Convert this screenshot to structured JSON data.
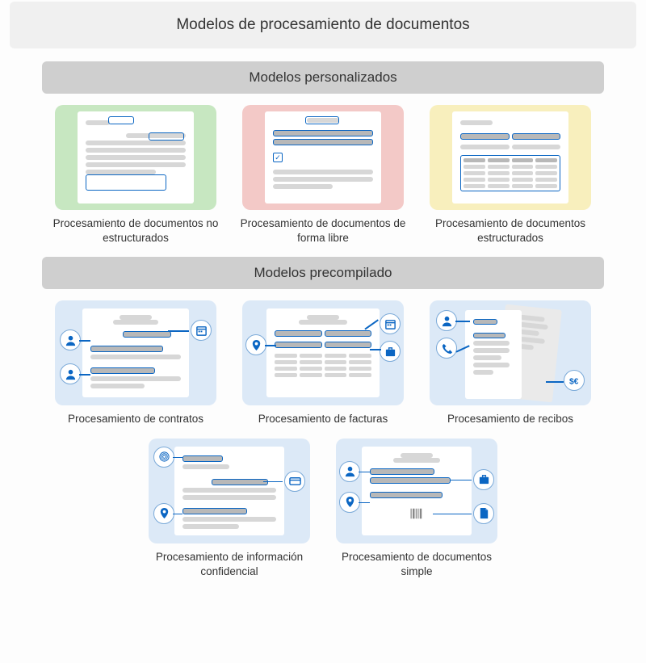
{
  "title": "Modelos de procesamiento de documentos",
  "sections": {
    "custom": {
      "heading": "Modelos personalizados",
      "cards": [
        {
          "label": "Procesamiento de documentos no estructurados"
        },
        {
          "label": "Procesamiento de documentos de forma libre"
        },
        {
          "label": "Procesamiento de documentos estructurados"
        }
      ]
    },
    "prebuilt": {
      "heading": "Modelos precompilado",
      "cards": [
        {
          "label": "Procesamiento de contratos"
        },
        {
          "label": "Procesamiento de facturas"
        },
        {
          "label": "Procesamiento de recibos"
        },
        {
          "label": "Procesamiento de información confidencial"
        },
        {
          "label": "Procesamiento de documentos simple"
        }
      ]
    }
  },
  "icons": {
    "person": "person-icon",
    "calendar": "calendar-icon",
    "location": "location-pin-icon",
    "briefcase": "briefcase-icon",
    "phone": "phone-icon",
    "currency": "currency-icon",
    "fingerprint": "fingerprint-icon",
    "creditcard": "credit-card-icon",
    "file": "file-icon",
    "barcode": "barcode-icon"
  },
  "colors": {
    "accent": "#0b66c3",
    "green": "#c7e7c1",
    "red": "#f3c9c7",
    "yellow": "#f8efbd",
    "blue": "#dce9f7"
  }
}
